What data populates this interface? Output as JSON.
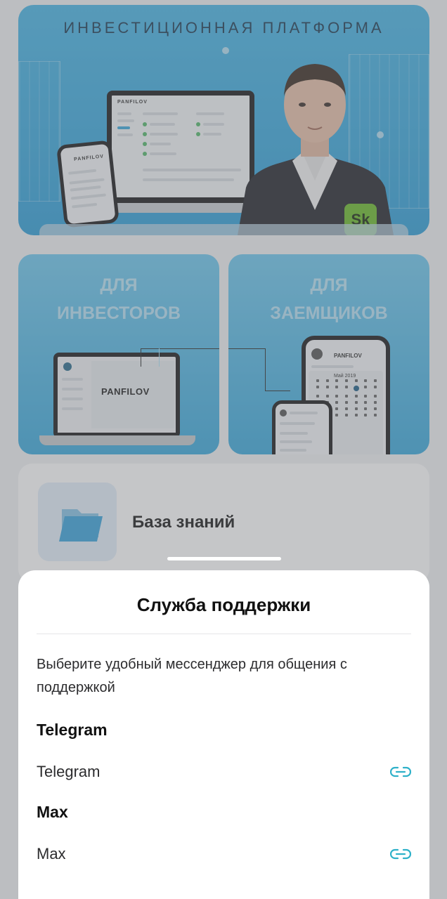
{
  "hero": {
    "title": "ИНВЕСТИЦИОННАЯ ПЛАТФОРМА",
    "laptop_brand": "PANFILOV",
    "phone_brand": "PANFILOV",
    "badge_text": "Sk"
  },
  "tiles": [
    {
      "title_line1": "ДЛЯ",
      "title_line2": "ИНВЕСТОРОВ",
      "brand": "PANFILOV"
    },
    {
      "title_line1": "ДЛЯ",
      "title_line2": "ЗАЕМЩИКОВ",
      "brand": "PANFILOV",
      "calendar_month": "Май 2019"
    }
  ],
  "knowledge_base": {
    "label": "База знаний",
    "icon": "folder-icon"
  },
  "support_sheet": {
    "title": "Служба поддержки",
    "description": "Выберите удобный мессенджер для общения с поддержкой",
    "sections": [
      {
        "heading": "Telegram",
        "link_label": "Telegram",
        "icon": "link-icon"
      },
      {
        "heading": "Max",
        "link_label": "Max",
        "icon": "link-icon"
      }
    ]
  },
  "colors": {
    "accent": "#2fb1c9",
    "hero_blue": "#3aa9dc",
    "sheet_bg": "#ffffff"
  }
}
